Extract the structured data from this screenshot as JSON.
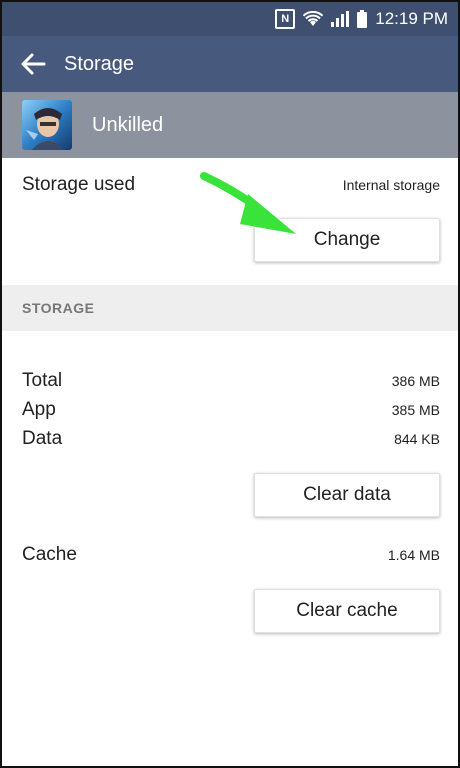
{
  "status_bar": {
    "nfc_label": "N",
    "time": "12:19 PM",
    "icons": [
      "nfc-icon",
      "wifi-icon",
      "signal-icon",
      "battery-icon"
    ]
  },
  "toolbar": {
    "title": "Storage",
    "back_icon": "arrow-left-icon"
  },
  "app": {
    "name": "Unkilled"
  },
  "storage_used": {
    "label": "Storage used",
    "value": "Internal storage",
    "change_button": "Change"
  },
  "section": {
    "title": "STORAGE"
  },
  "stats": [
    {
      "label": "Total",
      "value": "386 MB"
    },
    {
      "label": "App",
      "value": "385 MB"
    },
    {
      "label": "Data",
      "value": "844 KB"
    }
  ],
  "clear_data_button": "Clear data",
  "cache": {
    "label": "Cache",
    "value": "1.64 MB",
    "clear_cache_button": "Clear cache"
  },
  "colors": {
    "status_bar": "#3f4f70",
    "toolbar": "#475a7e",
    "app_header": "#8c929e",
    "section_bg": "#eeeeee",
    "annotation_arrow": "#39e33a"
  }
}
